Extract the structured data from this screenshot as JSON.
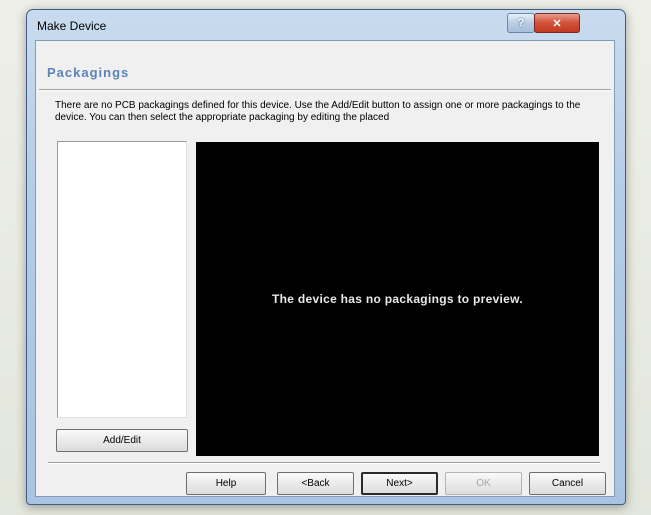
{
  "window": {
    "title": "Make Device",
    "help_glyph": "?",
    "close_glyph": "✕"
  },
  "section": {
    "title": "Packagings"
  },
  "description": "There are no PCB packagings defined for this device. Use the Add/Edit button to assign one or more packagings to the device. You can then select the appropriate packaging by editing the placed",
  "preview": {
    "message": "The device has no packagings to preview."
  },
  "buttons": {
    "add_edit": "Add/Edit",
    "help": "Help",
    "back": "<Back",
    "next": "Next>",
    "ok": "OK",
    "cancel": "Cancel"
  },
  "colors": {
    "section_title": "#5b84b9",
    "preview_background": "#000000",
    "close_button": "#c23a21"
  }
}
